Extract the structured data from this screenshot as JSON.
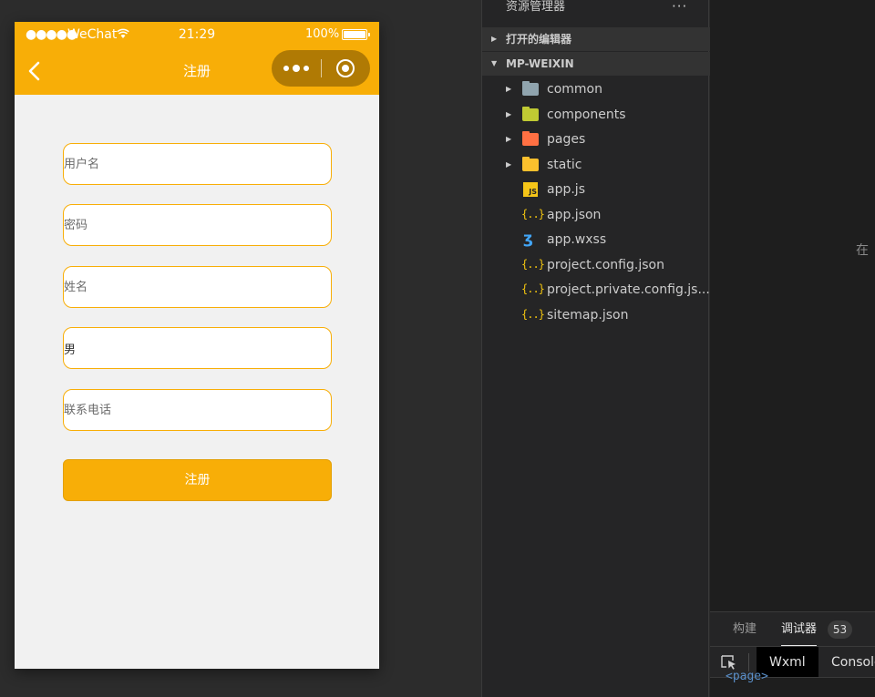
{
  "status_bar": {
    "signal": "●●●●●",
    "carrier": "WeChat",
    "time": "21:29",
    "battery": "100%"
  },
  "nav": {
    "title": "注册"
  },
  "form": {
    "username_placeholder": "用户名",
    "password_placeholder": "密码",
    "name_placeholder": "姓名",
    "gender_value": "男",
    "phone_placeholder": "联系电话",
    "submit_label": "注册"
  },
  "explorer": {
    "header": "资源管理器",
    "more": "···",
    "open_editors": "打开的编辑器",
    "project": "MP-WEIXIN",
    "folders": [
      {
        "name": "common",
        "icon": "folder-icon",
        "color": "#90a4ae"
      },
      {
        "name": "components",
        "icon": "components-folder-icon",
        "color": "#c0ca33"
      },
      {
        "name": "pages",
        "icon": "pages-folder-icon",
        "color": "#ff7043"
      },
      {
        "name": "static",
        "icon": "static-folder-icon",
        "color": "#fbc02d"
      }
    ],
    "files": [
      {
        "name": "app.js",
        "icon": "js-file-icon"
      },
      {
        "name": "app.json",
        "icon": "json-file-icon"
      },
      {
        "name": "app.wxss",
        "icon": "wxss-file-icon"
      },
      {
        "name": "project.config.json",
        "icon": "json-file-icon"
      },
      {
        "name": "project.private.config.js...",
        "icon": "json-file-icon"
      },
      {
        "name": "sitemap.json",
        "icon": "json-file-icon"
      }
    ]
  },
  "right_pane": {
    "partial_text": "在",
    "tabs": [
      {
        "label": "构建"
      },
      {
        "label": "调试器"
      }
    ],
    "count": "53",
    "sub_tabs": [
      {
        "label": "Wxml"
      },
      {
        "label": "Console"
      }
    ],
    "code_line": "<page>"
  },
  "colors": {
    "accent": "#f8ae07",
    "explorer_bg": "#252526"
  }
}
